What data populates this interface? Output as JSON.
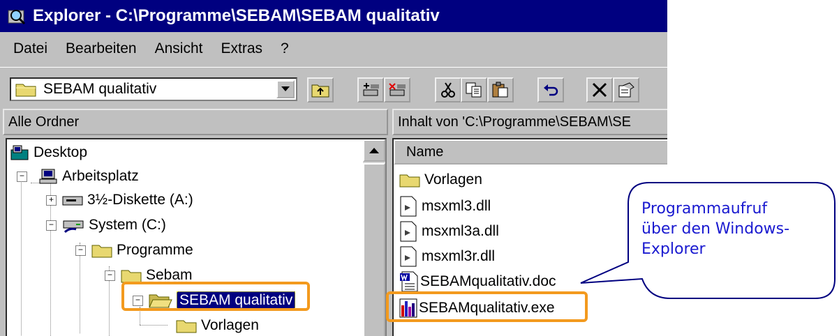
{
  "window": {
    "title": "Explorer - C:\\Programme\\SEBAM\\SEBAM qualitativ",
    "title_icon": "explorer-icon"
  },
  "menu": [
    "Datei",
    "Bearbeiten",
    "Ansicht",
    "Extras",
    "?"
  ],
  "toolbar": {
    "address_value": "SEBAM qualitativ",
    "buttons": [
      "up-folder-icon",
      "map-drive-icon",
      "disconnect-drive-icon",
      "cut-icon",
      "copy-icon",
      "paste-icon",
      "undo-icon",
      "delete-icon",
      "properties-icon"
    ]
  },
  "left_pane": {
    "header": "Alle Ordner",
    "tree": [
      {
        "label": "Desktop",
        "level": 0,
        "icon": "desktop-icon"
      },
      {
        "label": "Arbeitsplatz",
        "level": 1,
        "icon": "computer-icon",
        "expander": "−"
      },
      {
        "label": "3½-Diskette (A:)",
        "level": 2,
        "icon": "floppy-drive-icon",
        "expander": "+"
      },
      {
        "label": "System (C:)",
        "level": 2,
        "icon": "shared-drive-icon",
        "expander": "−"
      },
      {
        "label": "Programme",
        "level": 3,
        "icon": "folder-icon",
        "expander": "−"
      },
      {
        "label": "Sebam",
        "level": 4,
        "icon": "folder-icon",
        "expander": "−"
      },
      {
        "label": "SEBAM qualitativ",
        "level": 5,
        "icon": "open-folder-icon",
        "expander": "−",
        "selected": true
      },
      {
        "label": "Vorlagen",
        "level": 6,
        "icon": "folder-icon"
      }
    ]
  },
  "right_pane": {
    "header": "Inhalt von 'C:\\Programme\\SEBAM\\SE",
    "column": "Name",
    "files": [
      {
        "name": "Vorlagen",
        "icon": "folder-icon"
      },
      {
        "name": "msxml3.dll",
        "icon": "dll-file-icon"
      },
      {
        "name": "msxml3a.dll",
        "icon": "dll-file-icon"
      },
      {
        "name": "msxml3r.dll",
        "icon": "dll-file-icon"
      },
      {
        "name": "SEBAMqualitativ.doc",
        "icon": "word-document-icon"
      },
      {
        "name": "SEBAMqualitativ.exe",
        "icon": "chart-app-icon"
      }
    ]
  },
  "callout": {
    "lines": [
      "Programmaufruf",
      "über den Windows-",
      "Explorer"
    ],
    "text_color": "#1a1ad0"
  },
  "highlight_color": "#f39a1e"
}
